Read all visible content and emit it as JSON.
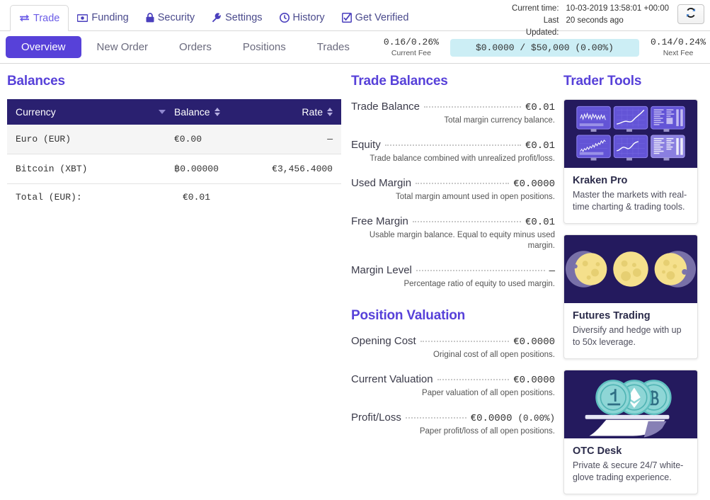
{
  "topnav": {
    "tabs": [
      {
        "label": "Trade",
        "icon": "exchange-arrows-icon",
        "active": true
      },
      {
        "label": "Funding",
        "icon": "banknote-icon",
        "active": false
      },
      {
        "label": "Security",
        "icon": "lock-icon",
        "active": false
      },
      {
        "label": "Settings",
        "icon": "wrench-icon",
        "active": false
      },
      {
        "label": "History",
        "icon": "clock-icon",
        "active": false
      },
      {
        "label": "Get Verified",
        "icon": "checkbox-checked-icon",
        "active": false
      }
    ],
    "current_time_label": "Current time:",
    "current_time_value": "10-03-2019 13:58:01 +00:00",
    "last_updated_label": "Last Updated:",
    "last_updated_value": "20 seconds ago",
    "refresh_icon": "refresh-icon"
  },
  "subnav": {
    "tabs": [
      {
        "label": "Overview",
        "active": true
      },
      {
        "label": "New Order",
        "active": false
      },
      {
        "label": "Orders",
        "active": false
      },
      {
        "label": "Positions",
        "active": false
      },
      {
        "label": "Trades",
        "active": false
      }
    ],
    "current_fee_value": "0.16/0.26%",
    "current_fee_label": "Current Fee",
    "volume_bar": "$0.0000 / $50,000 (0.00%)",
    "next_fee_value": "0.14/0.24%",
    "next_fee_label": "Next Fee"
  },
  "balances": {
    "title": "Balances",
    "columns": [
      {
        "label": "Currency",
        "sort": "desc"
      },
      {
        "label": "Balance",
        "sort": "both"
      },
      {
        "label": "Rate",
        "sort": "both"
      }
    ],
    "rows": [
      {
        "currency": "Euro (EUR)",
        "balance": "€0.00",
        "rate": "—"
      },
      {
        "currency": "Bitcoin (XBT)",
        "balance": "฿0.00000",
        "rate": "€3,456.4000"
      }
    ],
    "total_label": "Total (EUR):",
    "total_value": "€0.01",
    "total_rate": ""
  },
  "trade_balances": {
    "title": "Trade Balances",
    "items": [
      {
        "label": "Trade Balance",
        "value": "€0.01",
        "desc": "Total margin currency balance."
      },
      {
        "label": "Equity",
        "value": "€0.01",
        "desc": "Trade balance combined with unrealized profit/loss."
      },
      {
        "label": "Used Margin",
        "value": "€0.0000",
        "desc": "Total margin amount used in open positions."
      },
      {
        "label": "Free Margin",
        "value": "€0.01",
        "desc": "Usable margin balance. Equal to equity minus used margin."
      },
      {
        "label": "Margin Level",
        "value": "—",
        "desc": "Percentage ratio of equity to used margin."
      }
    ]
  },
  "position_valuation": {
    "title": "Position Valuation",
    "items": [
      {
        "label": "Opening Cost",
        "value": "€0.0000",
        "extra": "",
        "desc": "Original cost of all open positions."
      },
      {
        "label": "Current Valuation",
        "value": "€0.0000",
        "extra": "",
        "desc": "Paper valuation of all open positions."
      },
      {
        "label": "Profit/Loss",
        "value": "€0.0000",
        "extra": "(0.00%)",
        "desc": "Paper profit/loss of all open positions."
      }
    ]
  },
  "trader_tools": {
    "title": "Trader Tools",
    "cards": [
      {
        "art": "trading-monitors-illustration",
        "title": "Kraken Pro",
        "text": "Master the markets with real-time charting & trading tools."
      },
      {
        "art": "moons-illustration",
        "title": "Futures Trading",
        "text": "Diversify and hedge with up to 50x leverage."
      },
      {
        "art": "crypto-coins-tray-illustration",
        "title": "OTC Desk",
        "text": "Private & secure 24/7 white-glove trading experience."
      }
    ]
  },
  "colors": {
    "accent_purple": "#5741d9",
    "navy": "#2a2070",
    "card_art_navy": "#241a5e",
    "fee_bar_cyan": "#cceef5",
    "moon_yellow": "#f5e08c",
    "coin_teal": "#7fd3d3"
  }
}
